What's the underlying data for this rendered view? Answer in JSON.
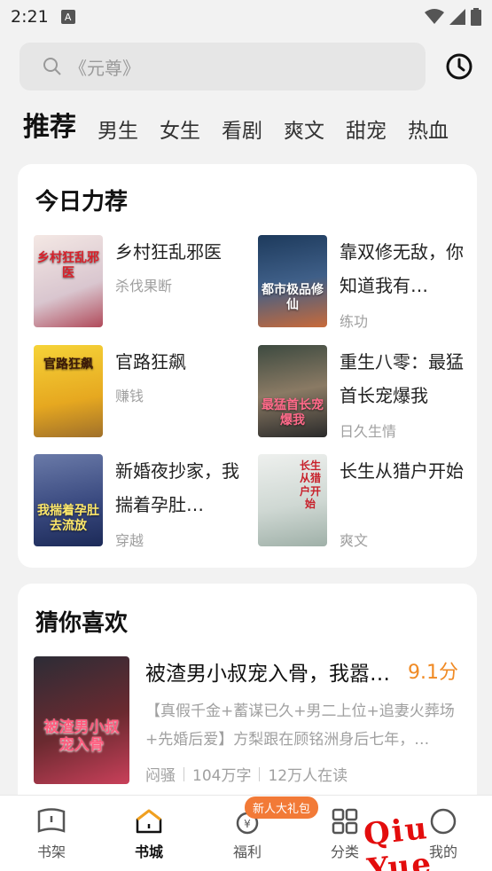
{
  "status": {
    "time": "2:21",
    "notification": "A"
  },
  "search": {
    "placeholder": "《元尊》"
  },
  "tabs": [
    {
      "label": "推荐"
    },
    {
      "label": "男生"
    },
    {
      "label": "女生"
    },
    {
      "label": "看剧"
    },
    {
      "label": "爽文"
    },
    {
      "label": "甜宠"
    },
    {
      "label": "热血"
    }
  ],
  "today": {
    "title": "今日力荐",
    "books": [
      {
        "title": "乡村狂乱邪医",
        "tag": "杀伐果断",
        "cover": "乡村狂乱邪医"
      },
      {
        "title": "靠双修无敌，你知道我有…",
        "tag": "练功",
        "cover": "都市极品修仙"
      },
      {
        "title": "官路狂飙",
        "tag": "赚钱",
        "cover": "官路狂飙"
      },
      {
        "title": "重生八零：最猛首长宠爆我",
        "tag": "日久生情",
        "cover": "最猛首长宠爆我"
      },
      {
        "title": "新婚夜抄家，我揣着孕肚…",
        "tag": "穿越",
        "cover": "我揣着孕肚去流放"
      },
      {
        "title": "长生从猎户开始",
        "tag": "爽文",
        "cover": "长生从猎户开始"
      }
    ]
  },
  "guess": {
    "title": "猜你喜欢",
    "book": {
      "title": "被渣男小叔宠入骨，我嚣…",
      "score": "9.1分",
      "desc": "【真假千金+蓄谋已久+男二上位+追妻火葬场+先婚后爱】方梨跟在顾铭洲身后七年，…",
      "tag": "闷骚",
      "words": "104万字",
      "readers": "12万人在读",
      "cover": "被渣男小叔宠入骨"
    }
  },
  "nav": {
    "items": [
      {
        "label": "书架"
      },
      {
        "label": "书城"
      },
      {
        "label": "福利"
      },
      {
        "label": "分类"
      },
      {
        "label": "我的"
      }
    ],
    "promo": "新人大礼包"
  },
  "watermark": "Qiu Yue",
  "colors": {
    "accent": "#f08a24",
    "promo": "#f27a37",
    "watermark": "#e30d0d"
  }
}
